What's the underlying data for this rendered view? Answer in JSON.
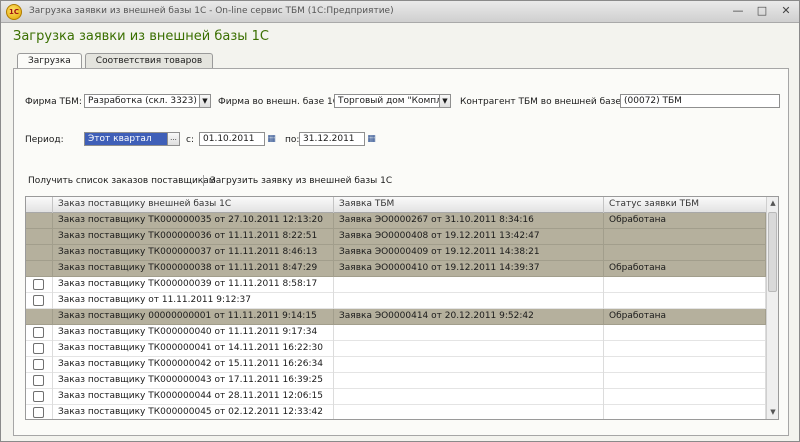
{
  "window": {
    "title": "Загрузка заявки из внешней базы 1С - On-line сервис ТБМ  (1С:Предприятие)",
    "app_icon_text": "1С"
  },
  "form": {
    "title": "Загрузка заявки из внешней базы 1С",
    "tabs": [
      {
        "label": "Загрузка",
        "active": true
      },
      {
        "label": "Соответствия товаров",
        "active": false
      }
    ],
    "firm_tbm": {
      "label": "Фирма ТБМ:",
      "value": "Разработка (скл. 3323)"
    },
    "firm_ext": {
      "label": "Фирма во внешн. базе 1С:",
      "value": "Торговый дом \"Комплекс\""
    },
    "contractor": {
      "label": "Контрагент ТБМ во внешней базе 1С:",
      "value": "(00072) ТБМ"
    },
    "period": {
      "label": "Период:",
      "value": "Этот квартал",
      "ellipsis": "...",
      "from_label": "с:",
      "from": "01.10.2011",
      "to_label": "по:",
      "to": "31.12.2011"
    },
    "actions": {
      "get_orders": "Получить список заказов поставщикам",
      "load_request": "Загрузить заявку из внешней базы 1С"
    }
  },
  "table": {
    "columns": [
      "Заказ поставщику внешней базы 1С",
      "Заявка ТБМ",
      "Статус заявки ТБМ"
    ],
    "rows": [
      {
        "order": "Заказ поставщику ТК000000035 от 27.10.2011 12:13:20",
        "request": "Заявка ЭО0000267 от 31.10.2011 8:34:16",
        "status": "Обработана",
        "selected": true,
        "checkbox": false
      },
      {
        "order": "Заказ поставщику ТК000000036 от 11.11.2011 8:22:51",
        "request": "Заявка ЭО0000408 от 19.12.2011 13:42:47",
        "status": "",
        "selected": true,
        "checkbox": false
      },
      {
        "order": "Заказ поставщику ТК000000037 от 11.11.2011 8:46:13",
        "request": "Заявка ЭО0000409 от 19.12.2011 14:38:21",
        "status": "",
        "selected": true,
        "checkbox": false
      },
      {
        "order": "Заказ поставщику ТК000000038 от 11.11.2011 8:47:29",
        "request": "Заявка ЭО0000410 от 19.12.2011 14:39:37",
        "status": "Обработана",
        "selected": true,
        "checkbox": false
      },
      {
        "order": "Заказ поставщику ТК000000039 от 11.11.2011 8:58:17",
        "request": "",
        "status": "",
        "selected": false,
        "checkbox": true
      },
      {
        "order": "Заказ поставщику  от 11.11.2011 9:12:37",
        "request": "",
        "status": "",
        "selected": false,
        "checkbox": true
      },
      {
        "order": "Заказ поставщику 00000000001 от 11.11.2011 9:14:15",
        "request": "Заявка ЭО0000414 от 20.12.2011 9:52:42",
        "status": "Обработана",
        "selected": true,
        "checkbox": false
      },
      {
        "order": "Заказ поставщику ТК000000040 от 11.11.2011 9:17:34",
        "request": "",
        "status": "",
        "selected": false,
        "checkbox": true
      },
      {
        "order": "Заказ поставщику ТК000000041 от 14.11.2011 16:22:30",
        "request": "",
        "status": "",
        "selected": false,
        "checkbox": true
      },
      {
        "order": "Заказ поставщику ТК000000042 от 15.11.2011 16:26:34",
        "request": "",
        "status": "",
        "selected": false,
        "checkbox": true
      },
      {
        "order": "Заказ поставщику ТК000000043 от 17.11.2011 16:39:25",
        "request": "",
        "status": "",
        "selected": false,
        "checkbox": true
      },
      {
        "order": "Заказ поставщику ТК000000044 от 28.11.2011 12:06:15",
        "request": "",
        "status": "",
        "selected": false,
        "checkbox": true
      },
      {
        "order": "Заказ поставщику ТК000000045 от 02.12.2011 12:33:42",
        "request": "",
        "status": "",
        "selected": false,
        "checkbox": true
      }
    ]
  },
  "icons": {
    "dropdown": "chevron-down-icon",
    "calendar": "calendar-icon",
    "close": "close-icon",
    "minimize": "minimize-icon",
    "maximize": "maximize-icon"
  },
  "colors": {
    "title_green": "#3a6f00",
    "selected_row": "#b5b09d",
    "period_highlight": "#3f5fb8"
  }
}
